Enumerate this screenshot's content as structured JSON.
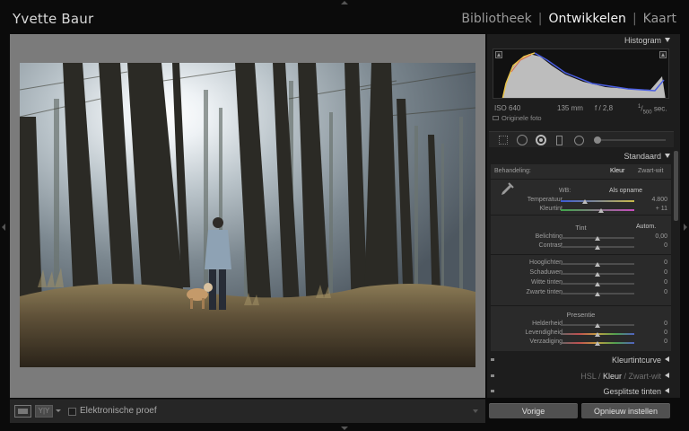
{
  "identity_plate": "Yvette Baur",
  "modules": [
    {
      "label": "Bibliotheek",
      "active": false
    },
    {
      "label": "Ontwikkelen",
      "active": true
    },
    {
      "label": "Kaart",
      "active": false
    }
  ],
  "module_separator": "|",
  "toolbar": {
    "softproof_label": "Elektronische proef",
    "view_mode_icons": [
      "loupe-view-icon",
      "before-after-icon"
    ]
  },
  "right_panel": {
    "histogram": {
      "title": "Histogram",
      "exif": {
        "iso": "ISO 640",
        "focal": "135 mm",
        "aperture": "f / 2,8",
        "shutter_num": "1",
        "shutter_den": "500",
        "shutter_unit": "sec."
      },
      "original_label": "Originele foto"
    },
    "basic": {
      "title": "Standaard",
      "treatment_label": "Behandeling:",
      "treatment_color": "Kleur",
      "treatment_bw": "Zwart-wit",
      "wb_label": "WB:",
      "wb_value": "Als opname",
      "rows_wb": [
        {
          "label": "Temperatuur",
          "value": "4.800",
          "level": 0.33,
          "track": "temp"
        },
        {
          "label": "Kleurtint",
          "value": "+ 11",
          "level": 0.55,
          "track": "tint"
        }
      ],
      "tone_title": "Tint",
      "tone_auto": "Autom.",
      "rows_tone1": [
        {
          "label": "Belichting",
          "value": "0,00",
          "level": 0.5
        },
        {
          "label": "Contrast",
          "value": "0",
          "level": 0.5
        }
      ],
      "rows_tone2": [
        {
          "label": "Hooglichten",
          "value": "0",
          "level": 0.5
        },
        {
          "label": "Schaduwen",
          "value": "0",
          "level": 0.5
        },
        {
          "label": "Witte tinten",
          "value": "0",
          "level": 0.5
        },
        {
          "label": "Zwarte tinten",
          "value": "0",
          "level": 0.5
        }
      ],
      "presence_title": "Presentie",
      "rows_presence": [
        {
          "label": "Helderheid",
          "value": "0",
          "level": 0.5
        },
        {
          "label": "Levendigheid",
          "value": "0",
          "level": 0.5,
          "track": "vib"
        },
        {
          "label": "Verzadiging",
          "value": "0",
          "level": 0.5,
          "track": "sat"
        }
      ]
    },
    "collapsed_panels": {
      "tone_curve": "Kleurtintcurve",
      "hsl": "HSL",
      "hsl_color": "Kleur",
      "hsl_bw": "Zwart-wit",
      "split_toning": "Gesplitste tinten"
    },
    "buttons": {
      "previous": "Vorige",
      "reset": "Opnieuw instellen"
    }
  },
  "colors": {
    "accent_active": "#f2f2f2",
    "panel_bg": "#2a2a2a",
    "canvas_bg": "#7b7b7b"
  }
}
